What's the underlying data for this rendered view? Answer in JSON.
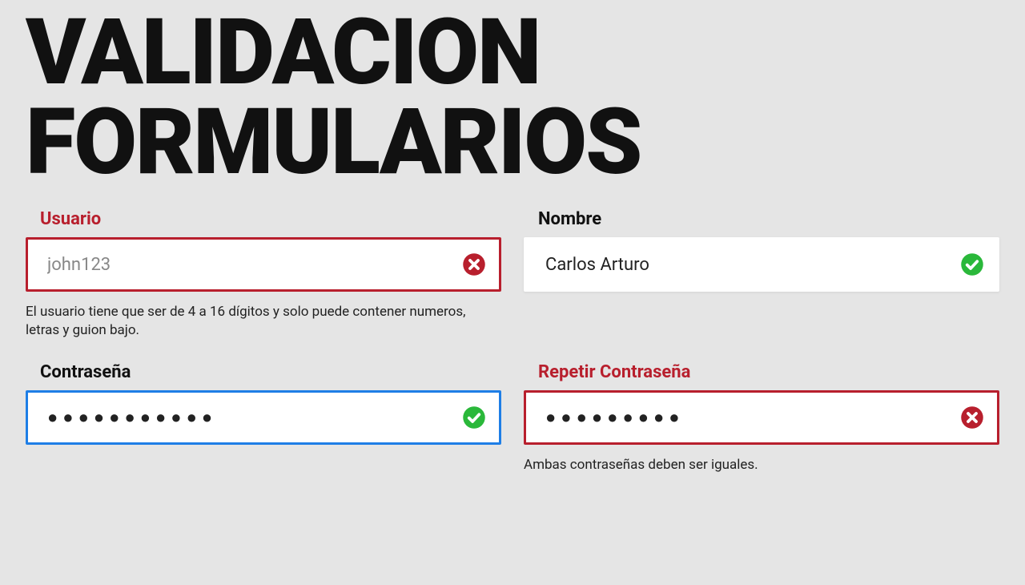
{
  "headline_line1": "VALIDACION",
  "headline_line2": "FORMULARIOS",
  "colors": {
    "error": "#b81f2d",
    "valid": "#2ab83a",
    "focus": "#1e7ee6",
    "text": "#111"
  },
  "fields": {
    "usuario": {
      "label": "Usuario",
      "placeholder": "john123",
      "state": "error",
      "hint": "El usuario tiene que ser de 4 a 16 dígitos y solo puede contener numeros, letras y guion bajo."
    },
    "nombre": {
      "label": "Nombre",
      "value": "Carlos Arturo",
      "state": "valid"
    },
    "contrasena": {
      "label": "Contraseña",
      "masked": "●●●●●●●●●●●",
      "state": "valid-focus"
    },
    "repetir": {
      "label": "Repetir Contraseña",
      "masked": "●●●●●●●●●",
      "state": "error",
      "hint": "Ambas contraseñas deben ser iguales."
    }
  }
}
